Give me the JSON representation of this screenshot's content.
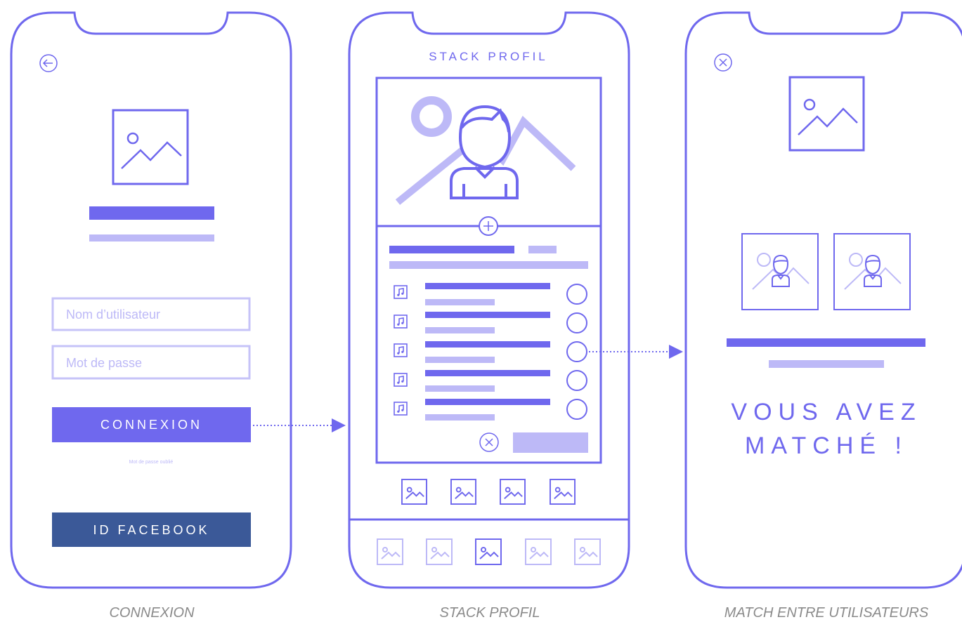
{
  "colors": {
    "accent": "#6f68ee",
    "light": "#bdb9f7",
    "facebook": "#3b5998",
    "caption": "#8a8a8a"
  },
  "connexion": {
    "caption": "CONNEXION",
    "username_placeholder": "Nom d’utilisateur",
    "password_placeholder": "Mot de passe",
    "login_label": "CONNEXION",
    "forgot_label": "Mot de passe oublié",
    "facebook_label": "ID FACEBOOK"
  },
  "stack": {
    "caption": "STACK PROFIL",
    "title": "STACK PROFIL"
  },
  "match": {
    "caption": "MATCH ENTRE UTILISATEURS",
    "line1": "VOUS AVEZ",
    "line2": "MATCHÉ !"
  }
}
